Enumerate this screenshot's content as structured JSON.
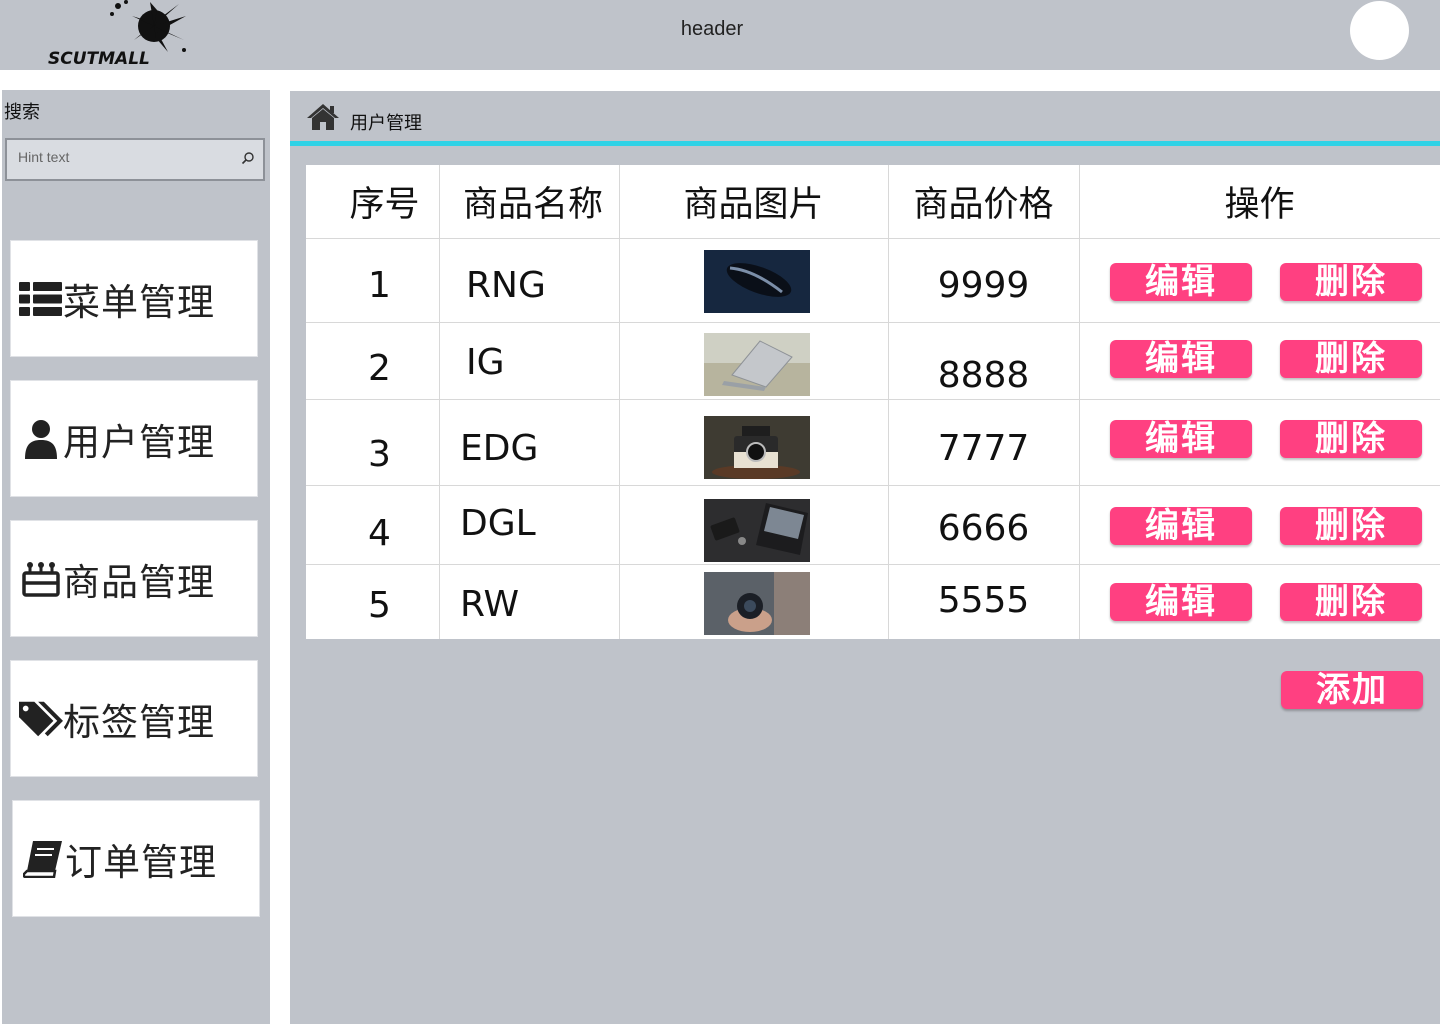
{
  "header": {
    "logo_text": "SCUTMALL",
    "title": "header"
  },
  "search": {
    "label": "搜索",
    "placeholder": "Hint text"
  },
  "sidebar": {
    "items": [
      {
        "label": "菜单管理",
        "icon": "list-icon"
      },
      {
        "label": "用户管理",
        "icon": "user-icon"
      },
      {
        "label": "商品管理",
        "icon": "gift-icon"
      },
      {
        "label": "标签管理",
        "icon": "tags-icon"
      },
      {
        "label": "订单管理",
        "icon": "book-icon"
      }
    ]
  },
  "breadcrumb": {
    "label": "用户管理",
    "icon": "home-icon"
  },
  "table": {
    "headers": [
      "序号",
      "商品名称",
      "商品图片",
      "商品价格",
      "操作"
    ],
    "rows": [
      {
        "id": "1",
        "name": "RNG",
        "image": "mouse-photo",
        "price": "9999"
      },
      {
        "id": "2",
        "name": "IG",
        "image": "laptop-photo",
        "price": "8888"
      },
      {
        "id": "3",
        "name": "EDG",
        "image": "instant-camera-photo",
        "price": "7777"
      },
      {
        "id": "4",
        "name": "DGL",
        "image": "desk-laptop-photo",
        "price": "6666"
      },
      {
        "id": "5",
        "name": "RW",
        "image": "lens-in-hand-photo",
        "price": "5555"
      }
    ],
    "edit_label": "编辑",
    "delete_label": "删除"
  },
  "add_label": "添加",
  "colors": {
    "panel_gray": "#bfc3ca",
    "accent_cyan": "#2fd2e6",
    "button_pink": "#ff4081"
  }
}
